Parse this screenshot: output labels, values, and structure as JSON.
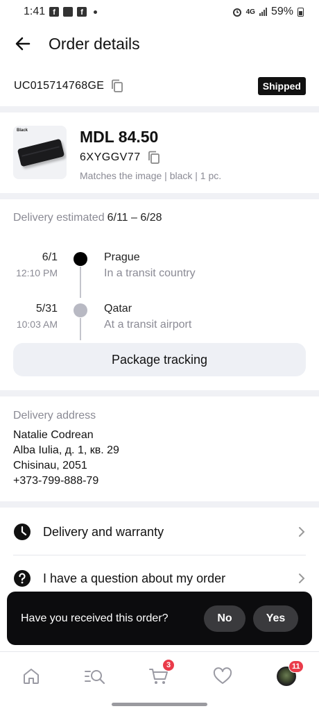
{
  "status_bar": {
    "time": "1:41",
    "fb_glyph": "f",
    "network": "4G",
    "battery": "59%"
  },
  "header": {
    "title": "Order details",
    "back_icon": "arrow-left-icon"
  },
  "order": {
    "id": "UC015714768GE",
    "status": "Shipped"
  },
  "product": {
    "thumb_label": "Black",
    "price": "MDL 84.50",
    "sku": "6XYGGV77",
    "variant": "Matches the image | black | 1 pc."
  },
  "delivery": {
    "estimate_label": "Delivery estimated",
    "estimate_value": "6/11 – 6/28"
  },
  "timeline": [
    {
      "date": "6/1",
      "time": "12:10 PM",
      "city": "Prague",
      "status": "In a transit country",
      "dot_color": "#000000"
    },
    {
      "date": "5/31",
      "time": "10:03 AM",
      "city": "Qatar",
      "status": "At a transit airport",
      "dot_color": "#b8b9c3"
    }
  ],
  "tracking_button": "Package tracking",
  "address": {
    "label": "Delivery address",
    "name": "Natalie Codrean",
    "street": "Alba Iulia, д. 1, кв. 29",
    "city": "Chisinau, 2051",
    "phone": "+373-799-888-79"
  },
  "menu": [
    {
      "label": "Delivery and warranty",
      "icon": "clock-icon"
    },
    {
      "label": "I have a question about my order",
      "icon": "question-icon"
    }
  ],
  "toast": {
    "question": "Have you received this order?",
    "no": "No",
    "yes": "Yes"
  },
  "tabbar": {
    "cart_count": "3",
    "account_count": "11"
  }
}
